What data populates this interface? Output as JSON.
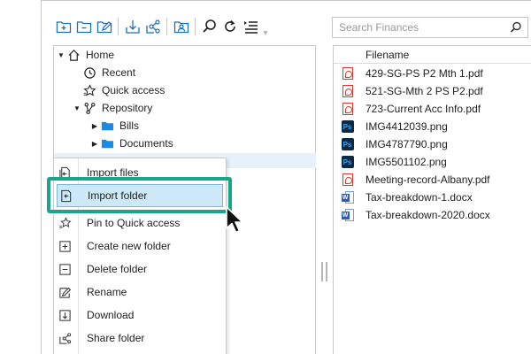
{
  "search": {
    "placeholder": "Search Finances"
  },
  "toolbar": {
    "buttons": [
      {
        "name": "new-folder-icon"
      },
      {
        "name": "remove-folder-icon"
      },
      {
        "name": "rename-folder-icon"
      },
      {
        "name": "download-icon"
      },
      {
        "name": "share-icon"
      },
      {
        "name": "user-folder-icon"
      },
      {
        "name": "search-icon"
      },
      {
        "name": "refresh-icon"
      },
      {
        "name": "list-menu-icon"
      }
    ]
  },
  "tree": {
    "items": [
      {
        "label": "Home",
        "icon": "home-icon",
        "arrow": "▼"
      },
      {
        "label": "Recent",
        "icon": "clock-icon",
        "arrow": ""
      },
      {
        "label": "Quick access",
        "icon": "star-icon",
        "arrow": ""
      },
      {
        "label": "Repository",
        "icon": "repository-icon",
        "arrow": "▼"
      },
      {
        "label": "Bills",
        "icon": "folder-icon",
        "arrow": "▶"
      },
      {
        "label": "Documents",
        "icon": "folder-icon",
        "arrow": "▶"
      }
    ]
  },
  "files": {
    "header": "Filename",
    "items": [
      {
        "name": "429-SG-PS P2 Mth 1.pdf",
        "type": "pdf"
      },
      {
        "name": "521-SG-Mth 2 PS P2.pdf",
        "type": "pdf"
      },
      {
        "name": "723-Current Acc Info.pdf",
        "type": "pdf"
      },
      {
        "name": "IMG4412039.png",
        "type": "ps"
      },
      {
        "name": "IMG4787790.png",
        "type": "ps"
      },
      {
        "name": "IMG5501102.png",
        "type": "ps"
      },
      {
        "name": "Meeting-record-Albany.pdf",
        "type": "pdf"
      },
      {
        "name": "Tax-breakdown-1.docx",
        "type": "doc"
      },
      {
        "name": "Tax-breakdown-2020.docx",
        "type": "doc"
      }
    ]
  },
  "menu": {
    "items": [
      {
        "label": "Import files",
        "icon": "import-files-icon"
      },
      {
        "label": "Import folder",
        "icon": "import-folder-icon",
        "active": true
      },
      {
        "label": "Pin to Quick access",
        "icon": "pin-star-icon"
      },
      {
        "label": "Create new folder",
        "icon": "create-folder-icon"
      },
      {
        "label": "Delete folder",
        "icon": "delete-folder-icon"
      },
      {
        "label": "Rename",
        "icon": "rename-icon"
      },
      {
        "label": "Download",
        "icon": "download-icon"
      },
      {
        "label": "Share folder",
        "icon": "share-folder-icon"
      }
    ]
  },
  "colors": {
    "accent_folder": "#1e88e5",
    "toolbar_icon": "#1a6fb5",
    "highlight_ring": "#1aa58a",
    "menu_active_bg": "#cde8f7"
  }
}
